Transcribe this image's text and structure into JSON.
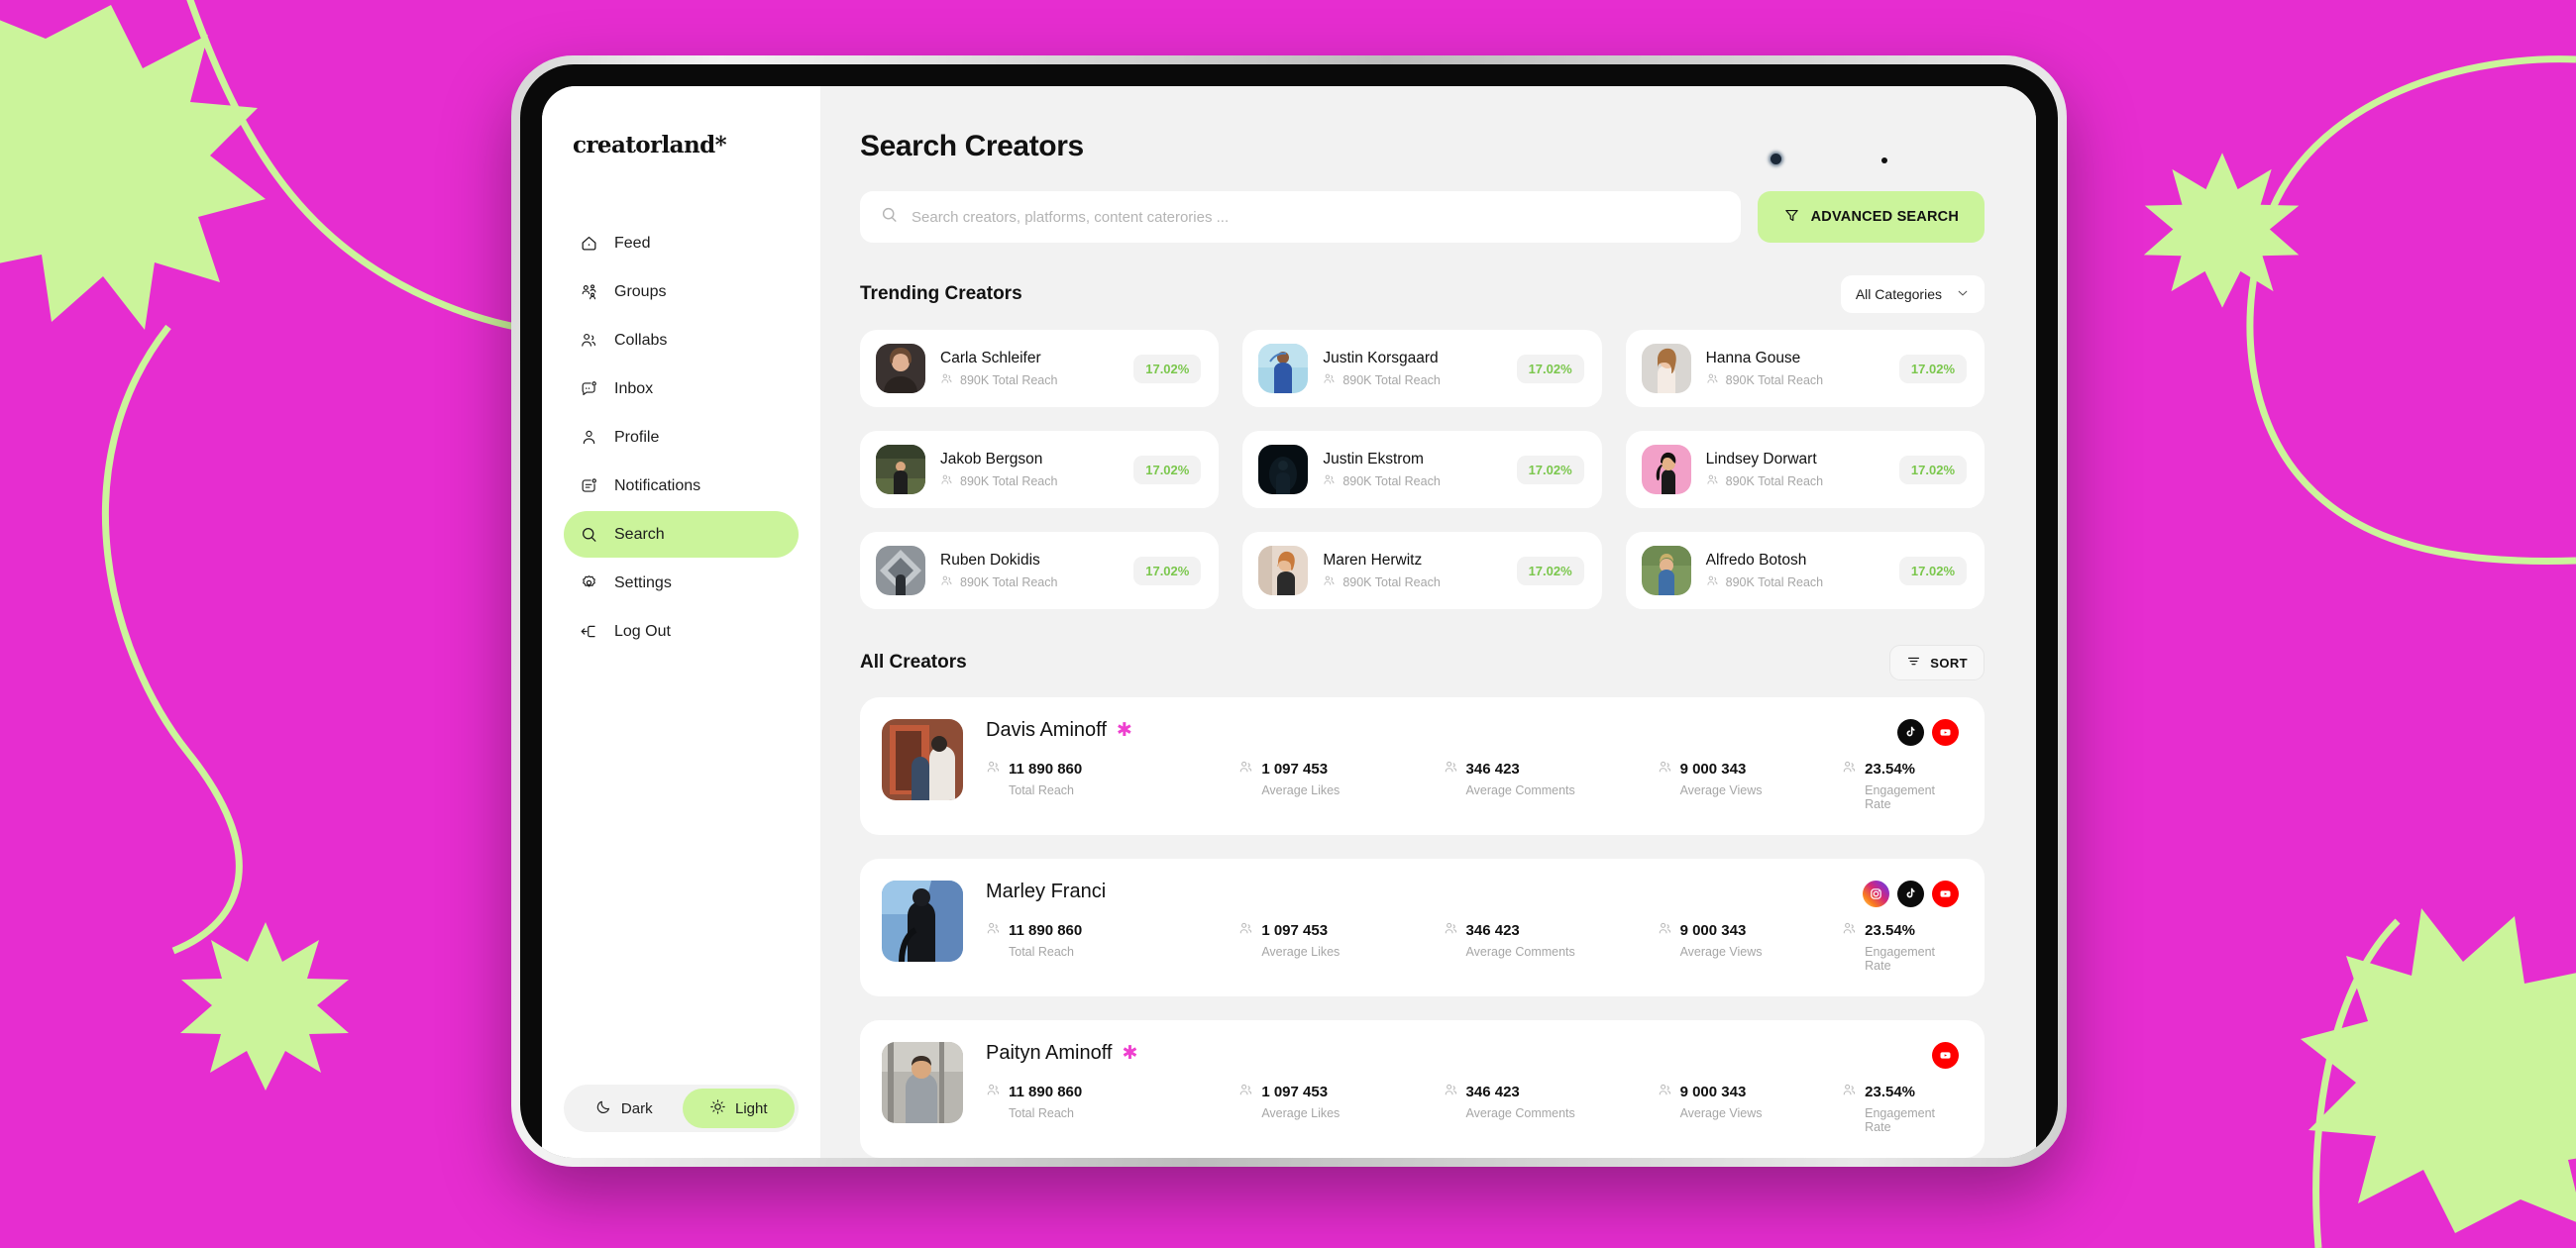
{
  "brand": {
    "logo": "creatorland*",
    "green": "#CBF49B",
    "magenta": "#E62DD0",
    "badge_green": "#7BC74D",
    "star_pink": "#EE40CF"
  },
  "sidebar": {
    "items": [
      {
        "label": "Feed",
        "icon": "home-icon",
        "active": false
      },
      {
        "label": "Groups",
        "icon": "groups-icon",
        "active": false
      },
      {
        "label": "Collabs",
        "icon": "collabs-icon",
        "active": false
      },
      {
        "label": "Inbox",
        "icon": "inbox-icon",
        "active": false
      },
      {
        "label": "Profile",
        "icon": "profile-icon",
        "active": false
      },
      {
        "label": "Notifications",
        "icon": "notifications-icon",
        "active": false
      },
      {
        "label": "Search",
        "icon": "search-icon",
        "active": true
      },
      {
        "label": "Settings",
        "icon": "gear-icon",
        "active": false
      },
      {
        "label": "Log Out",
        "icon": "logout-icon",
        "active": false
      }
    ],
    "theme": {
      "dark_label": "Dark",
      "light_label": "Light",
      "selected": "Light"
    }
  },
  "header": {
    "title": "Search Creators",
    "search_placeholder": "Search creators, platforms, content caterories ...",
    "search_value": "",
    "advanced_button": "ADVANCED SEARCH"
  },
  "trending": {
    "title": "Trending Creators",
    "category_filter": "All Categories",
    "cards": [
      {
        "name": "Carla Schleifer",
        "reach": "890K Total Reach",
        "rate": "17.02%",
        "avatar": "#3a3230"
      },
      {
        "name": "Justin Korsgaard",
        "reach": "890K Total Reach",
        "rate": "17.02%",
        "avatar": "#9ed0e8"
      },
      {
        "name": "Hanna Gouse",
        "reach": "890K Total Reach",
        "rate": "17.02%",
        "avatar": "#d7d3cf"
      },
      {
        "name": "Jakob Bergson",
        "reach": "890K Total Reach",
        "rate": "17.02%",
        "avatar": "#3c4431"
      },
      {
        "name": "Justin Ekstrom",
        "reach": "890K Total Reach",
        "rate": "17.02%",
        "avatar": "#0b1418"
      },
      {
        "name": "Lindsey Dorwart",
        "reach": "890K Total Reach",
        "rate": "17.02%",
        "avatar": "#f0a8c8"
      },
      {
        "name": "Ruben Dokidis",
        "reach": "890K Total Reach",
        "rate": "17.02%",
        "avatar": "#8a8f94"
      },
      {
        "name": "Maren Herwitz",
        "reach": "890K Total Reach",
        "rate": "17.02%",
        "avatar": "#e2cfc4"
      },
      {
        "name": "Alfredo Botosh",
        "reach": "890K Total Reach",
        "rate": "17.02%",
        "avatar": "#7c8f63"
      }
    ]
  },
  "all_creators": {
    "title": "All Creators",
    "sort_label": "SORT",
    "stat_labels": [
      "Total Reach",
      "Average Likes",
      "Average Comments",
      "Average Views",
      "Engagement Rate"
    ],
    "rows": [
      {
        "name": "Davis Aminoff",
        "verified": true,
        "avatar": "#b6543a",
        "socials": [
          "tiktok-icon",
          "youtube-icon"
        ],
        "stats": [
          "11 890 860",
          "1 097 453",
          "346 423",
          "9 000 343",
          "23.54%"
        ]
      },
      {
        "name": "Marley Franci",
        "verified": false,
        "avatar": "#5f86ba",
        "socials": [
          "instagram-icon",
          "tiktok-icon",
          "youtube-icon"
        ],
        "stats": [
          "11 890 860",
          "1 097 453",
          "346 423",
          "9 000 343",
          "23.54%"
        ]
      },
      {
        "name": "Paityn Aminoff",
        "verified": true,
        "avatar": "#9a9892",
        "socials": [
          "youtube-icon"
        ],
        "stats": [
          "11 890 860",
          "1 097 453",
          "346 423",
          "9 000 343",
          "23.54%"
        ]
      }
    ]
  }
}
